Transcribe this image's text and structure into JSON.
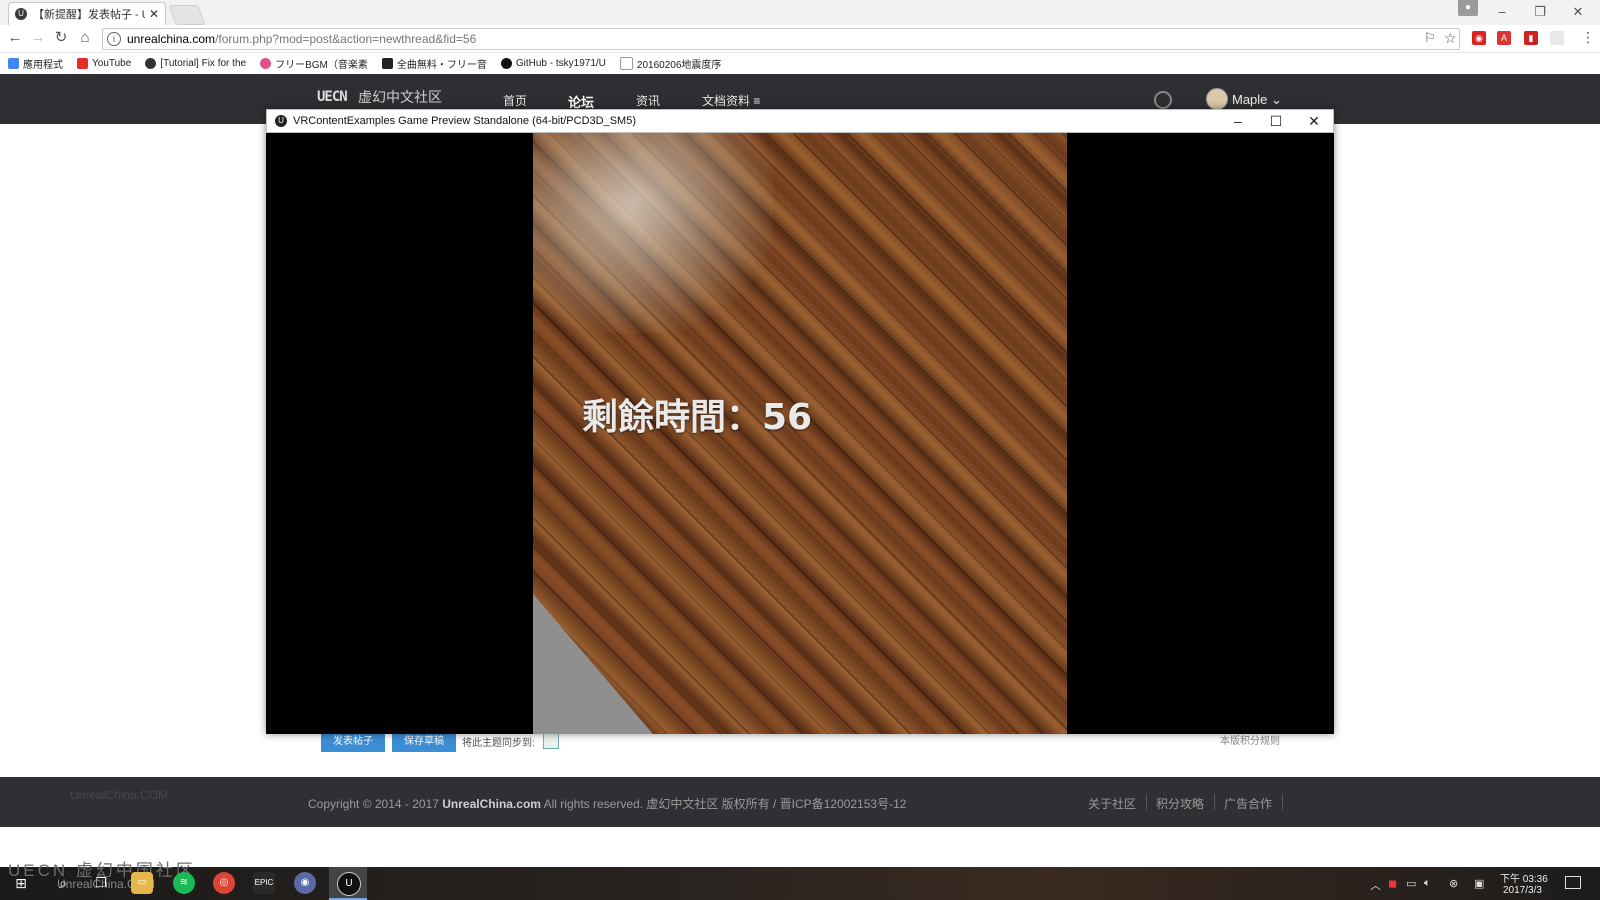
{
  "browser": {
    "tab_title": "【新提醒】发表帖子 - Ur",
    "tab_close": "✕",
    "url_host": "unrealchina.com",
    "url_path": "/forum.php?mod=post&action=newthread&fid=56",
    "bookmarks": [
      {
        "label": "應用程式",
        "icon_color": "#4285f4",
        "icon": "apps-icon"
      },
      {
        "label": "YouTube",
        "icon_color": "#e52d27",
        "icon": "youtube-icon"
      },
      {
        "label": "[Tutorial] Fix for the",
        "icon_color": "#333333",
        "icon": "unreal-icon"
      },
      {
        "label": "フリーBGM（音楽素",
        "icon_color": "#e0508a",
        "icon": "music-icon"
      },
      {
        "label": "全曲無料・フリー音",
        "icon_color": "#222222",
        "icon": "site-icon"
      },
      {
        "label": "GitHub - tsky1971/U",
        "icon_color": "#111111",
        "icon": "github-icon"
      },
      {
        "label": "20160206地震度序",
        "icon_color": "#999999",
        "icon": "page-icon"
      }
    ]
  },
  "site": {
    "logo": "UECN",
    "name": "虚幻中文社区",
    "nav": [
      "首页",
      "论坛",
      "资讯",
      "文档资料 ≡"
    ],
    "username": "Maple ⌄"
  },
  "page": {
    "post_button": "发表帖子",
    "draft_button": "保存草稿",
    "sync_label": "将此主题同步到:",
    "rules_link": "本版积分规则"
  },
  "footer": {
    "watermark": "UnrealChina.COM",
    "copyright_prefix": "Copyright © 2014 - 2017 ",
    "copyright_brand": "UnrealChina.com",
    "copyright_suffix": " All rights reserved. 虚幻中文社区 版权所有 / 晋ICP备12002153号-12",
    "links": [
      "关于社区",
      "积分攻略",
      "广告合作"
    ]
  },
  "game_window": {
    "title": "VRContentExamples Game Preview Standalone (64-bit/PCD3D_SM5)",
    "minimize": "–",
    "maximize": "☐",
    "close": "✕",
    "hud_text": "剩餘時間：56"
  },
  "taskbar": {
    "watermark_cn": "UECN 虚幻中国社区",
    "watermark_en": "UnrealChina.COM",
    "clock_time": "下午 03:36",
    "clock_date": "2017/3/3"
  }
}
